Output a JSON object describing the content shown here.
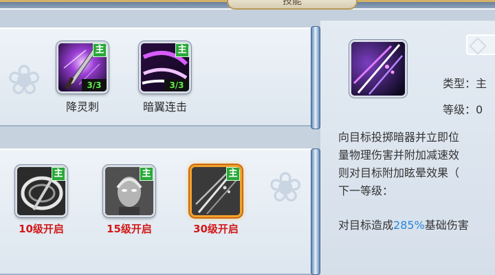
{
  "header": {
    "title": "技能"
  },
  "top_row": [
    {
      "name": "降灵刺",
      "main_badge": "主",
      "count": "3/3"
    },
    {
      "name": "暗翼连击",
      "main_badge": "主",
      "count": "3/3"
    }
  ],
  "bottom_row": [
    {
      "unlock": "10级开启",
      "main_badge": "主"
    },
    {
      "unlock": "15级开启",
      "main_badge": "主"
    },
    {
      "unlock": "30级开启",
      "main_badge": "主",
      "selected": true
    }
  ],
  "detail": {
    "type_label": "类型：主",
    "level_label": "等级：0",
    "description_lines": [
      "向目标投掷暗器并立即位",
      "量物理伤害并附加减速效",
      "则对目标附加眩晕效果（"
    ],
    "next_level_label": "下一等级：",
    "next_effect": {
      "prefix": "对目标造成",
      "percent": "285%",
      "suffix": "基础伤害"
    }
  }
}
